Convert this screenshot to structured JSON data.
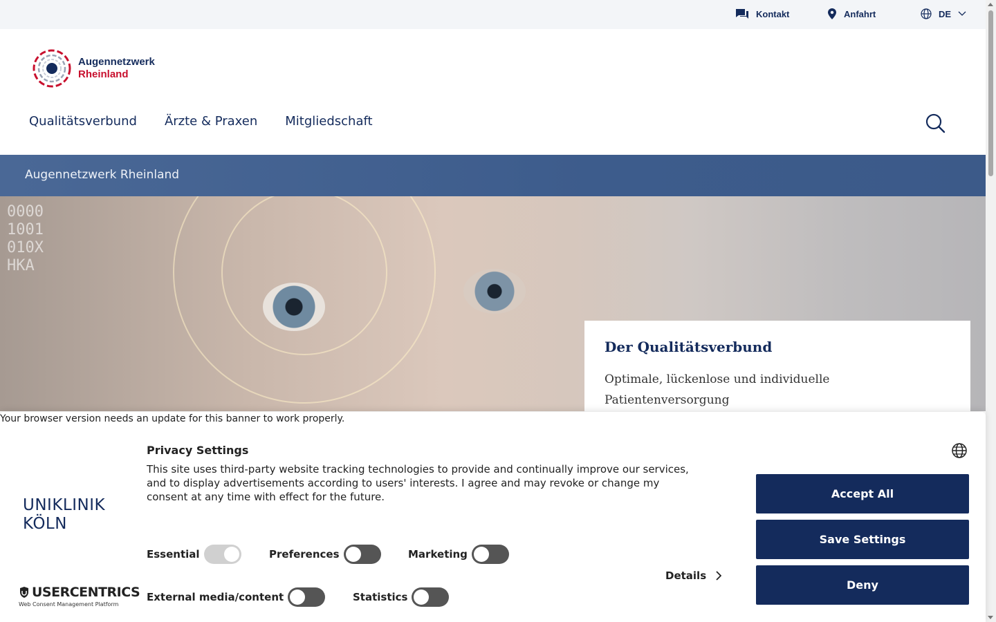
{
  "utility": {
    "contact_label": "Kontakt",
    "directions_label": "Anfahrt",
    "language_label": "DE"
  },
  "logo": {
    "line1": "Augennetzwerk",
    "line2": "Rheinland"
  },
  "nav": {
    "items": [
      {
        "label": "Qualitätsverbund"
      },
      {
        "label": "Ärzte & Praxen"
      },
      {
        "label": "Mitgliedschaft"
      }
    ]
  },
  "breadcrumb": {
    "label": "Augennetzwerk Rheinland"
  },
  "hero": {
    "digits": "00001001010XHKA"
  },
  "card": {
    "title": "Der Qualitätsverbund",
    "text": "Optimale, lückenlose und individuelle Patientenversorgung"
  },
  "consent": {
    "browser_note": "Your browser version needs an update for this banner to work properly.",
    "brand_line1": "UNIKLINIK",
    "brand_line2": "KÖLN",
    "uc_title": "USERCENTRICS",
    "uc_sub": "Web Consent Management Platform",
    "title": "Privacy Settings",
    "text": "This site uses third-party website tracking technologies to provide and continually improve our services, and to display advertisements according to users' interests. I agree and may revoke or change my consent at any time with effect for the future.",
    "toggles": {
      "essential": "Essential",
      "preferences": "Preferences",
      "marketing": "Marketing",
      "external": "External media/content",
      "statistics": "Statistics"
    },
    "details_label": "Details",
    "accept_label": "Accept All",
    "save_label": "Save Settings",
    "deny_label": "Deny"
  },
  "colors": {
    "brand_navy": "#142b5c",
    "brand_red": "#c8102e",
    "breadcrumb_band": "#3d5c8c"
  }
}
